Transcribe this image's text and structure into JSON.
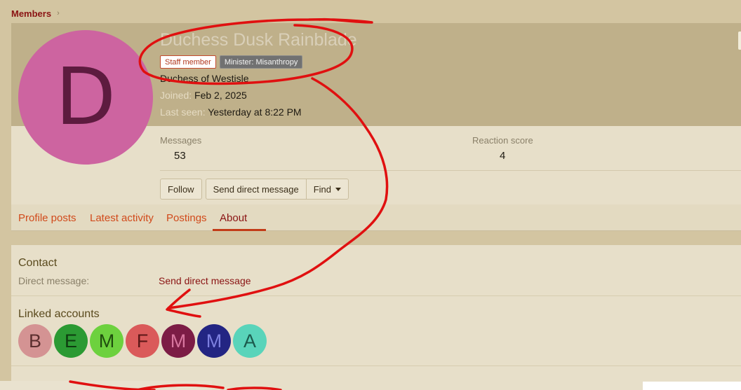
{
  "breadcrumb": {
    "items": [
      "Members"
    ],
    "separator": "›"
  },
  "profile": {
    "avatar_letter": "D",
    "avatar_color": "#cd64a0",
    "name": "Duchess Dusk Rainblade",
    "badges": [
      "Staff member",
      "Minister: Misanthropy"
    ],
    "title": "Duchess of Westisle",
    "joined_label": "Joined:",
    "joined_value": "Feb 2, 2025",
    "last_seen_label": "Last seen:",
    "last_seen_value": "Yesterday at 8:22 PM",
    "stats": {
      "messages_label": "Messages",
      "messages_value": "53",
      "reaction_label": "Reaction score",
      "reaction_value": "4"
    },
    "actions": {
      "follow": "Follow",
      "send_dm": "Send direct message",
      "find": "Find"
    }
  },
  "tabs": [
    {
      "label": "Profile posts",
      "active": false
    },
    {
      "label": "Latest activity",
      "active": false
    },
    {
      "label": "Postings",
      "active": false
    },
    {
      "label": "About",
      "active": true
    }
  ],
  "about": {
    "contact_title": "Contact",
    "dm_label": "Direct message:",
    "dm_link": "Send direct message",
    "linked_title": "Linked accounts",
    "linked_accounts": [
      {
        "letter": "B",
        "bg": "#d49393",
        "fg": "#5c2f2f"
      },
      {
        "letter": "E",
        "bg": "#2b9a33",
        "fg": "#0e3b10"
      },
      {
        "letter": "M",
        "bg": "#6dd13e",
        "fg": "#1f4d0e"
      },
      {
        "letter": "F",
        "bg": "#da5a5a",
        "fg": "#5c1717"
      },
      {
        "letter": "M",
        "bg": "#7c1c45",
        "fg": "#d8769f"
      },
      {
        "letter": "M",
        "bg": "#232583",
        "fg": "#7d80e0"
      },
      {
        "letter": "A",
        "bg": "#59d4ba",
        "fg": "#1b5a4c"
      }
    ]
  },
  "colors": {
    "page_bg": "#d3c5a1",
    "header_bg": "#bfb08a",
    "card_bg": "#e7dfc9",
    "link": "#8a1313",
    "tab_link": "#d14a1b",
    "annotation": "#e01010"
  }
}
